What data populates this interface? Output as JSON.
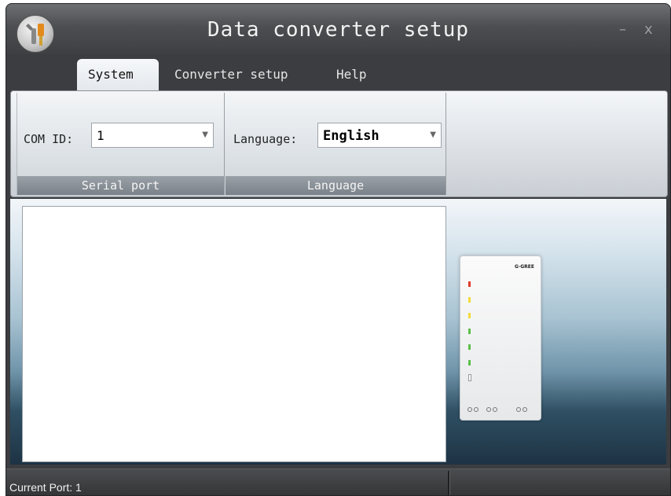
{
  "window": {
    "title": "Data converter setup",
    "minimize_glyph": "–",
    "close_glyph": "x"
  },
  "menu": {
    "tabs": [
      {
        "label": "System",
        "active": true
      },
      {
        "label": "Converter setup",
        "active": false
      },
      {
        "label": "Help",
        "active": false
      }
    ]
  },
  "ribbon": {
    "serial_port": {
      "group_label": "Serial port",
      "com_id_label": "COM ID:",
      "com_id_value": "1"
    },
    "language": {
      "group_label": "Language",
      "language_label": "Language:",
      "language_value": "English"
    }
  },
  "status": {
    "current_port": "Current Port: 1"
  },
  "icons": {
    "app": "wrench-app-icon",
    "combo_arrow": "chevron-down-icon"
  },
  "colors": {
    "window_frame": "#3b3d40",
    "ribbon_label": "#7a8189",
    "content_gradient_top": "#f2f6f9",
    "content_gradient_bottom": "#1d3344"
  }
}
